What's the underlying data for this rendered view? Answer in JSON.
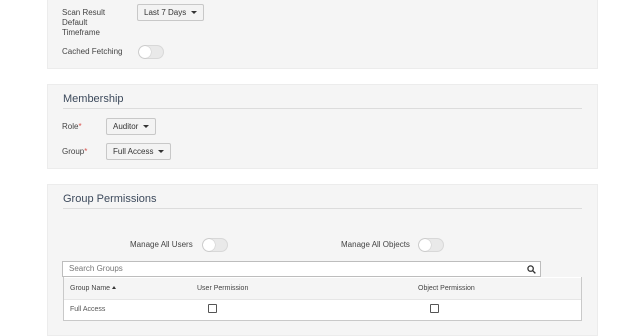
{
  "general": {
    "scan_result_label_1": "Scan Result",
    "scan_result_label_2": "Default",
    "scan_result_label_3": "Timeframe",
    "timeframe_value": "Last 7 Days",
    "cached_fetching_label": "Cached Fetching",
    "cached_fetching_on": false
  },
  "membership": {
    "title": "Membership",
    "role_label": "Role",
    "role_value": "Auditor",
    "group_label": "Group",
    "group_value": "Full Access",
    "required_mark": "*"
  },
  "group_permissions": {
    "title": "Group Permissions",
    "manage_all_users_label": "Manage All Users",
    "manage_all_users_on": false,
    "manage_all_objects_label": "Manage All Objects",
    "manage_all_objects_on": false,
    "search_placeholder": "Search Groups",
    "columns": [
      "Group Name",
      "User Permission",
      "Object Permission"
    ],
    "rows": [
      {
        "group_name": "Full Access",
        "user_permission": false,
        "object_permission": false
      }
    ]
  }
}
